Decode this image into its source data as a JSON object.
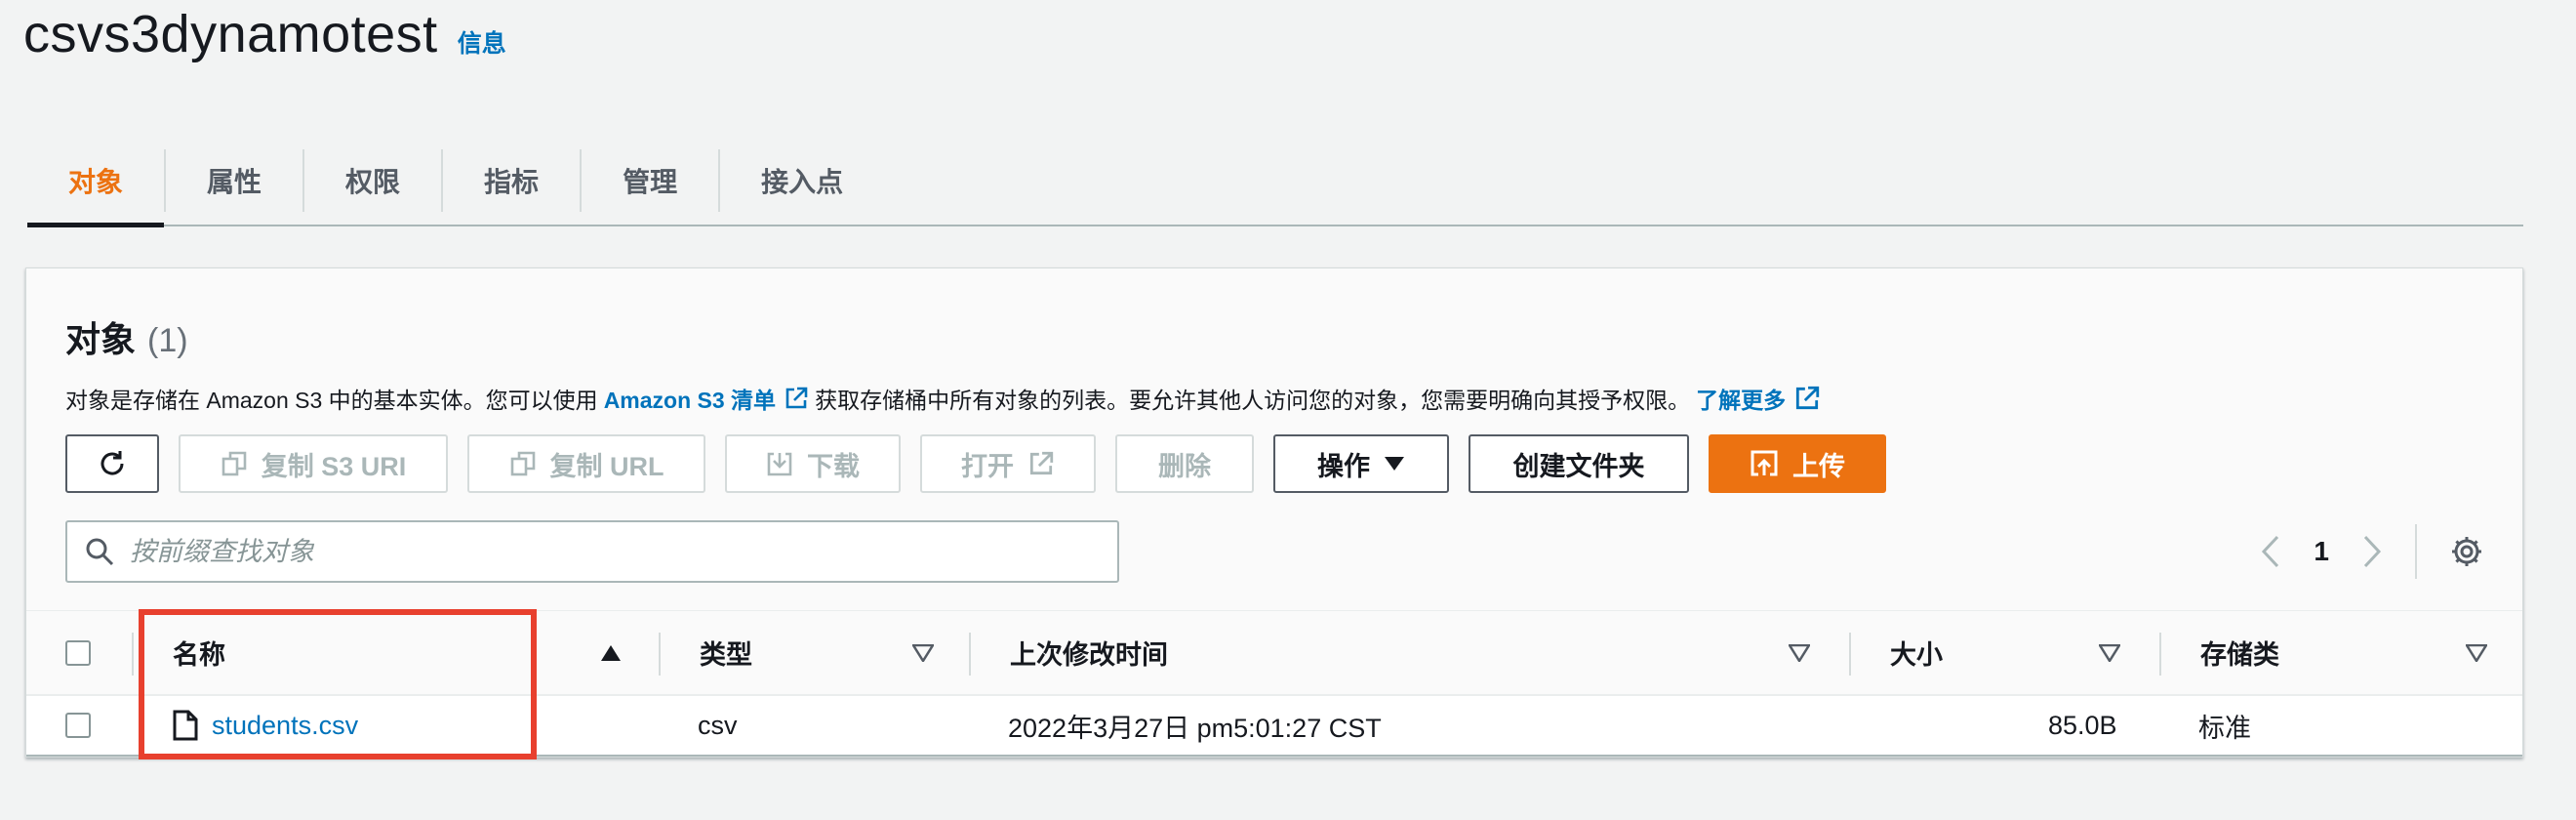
{
  "header": {
    "bucket_name": "csvs3dynamotest",
    "info_link": "信息"
  },
  "tabs": [
    {
      "label": "对象",
      "active": true
    },
    {
      "label": "属性",
      "active": false
    },
    {
      "label": "权限",
      "active": false
    },
    {
      "label": "指标",
      "active": false
    },
    {
      "label": "管理",
      "active": false
    },
    {
      "label": "接入点",
      "active": false
    }
  ],
  "objects_panel": {
    "title": "对象",
    "count": "(1)",
    "description_part1": "对象是存储在 Amazon S3 中的基本实体。您可以使用",
    "inventory_link": "Amazon S3 清单",
    "description_part2": "获取存储桶中所有对象的列表。要允许其他人访问您的对象，您需要明确向其授予权限。",
    "learn_more_link": "了解更多"
  },
  "toolbar": {
    "refresh_icon": "refresh-icon",
    "copy_s3_uri": "复制 S3 URI",
    "copy_url": "复制 URL",
    "download": "下载",
    "open": "打开",
    "delete": "删除",
    "actions": "操作",
    "create_folder": "创建文件夹",
    "upload": "上传"
  },
  "search": {
    "placeholder": "按前缀查找对象"
  },
  "pagination": {
    "current_page": "1"
  },
  "table": {
    "columns": [
      "名称",
      "类型",
      "上次修改时间",
      "大小",
      "存储类"
    ],
    "rows": [
      {
        "name": "students.csv",
        "type": "csv",
        "last_modified": "2022年3月27日 pm5:01:27 CST",
        "size": "85.0B",
        "storage_class": "标准"
      }
    ]
  },
  "colors": {
    "accent": "#ec7211",
    "link": "#0073bb",
    "highlight": "#e8402e"
  }
}
